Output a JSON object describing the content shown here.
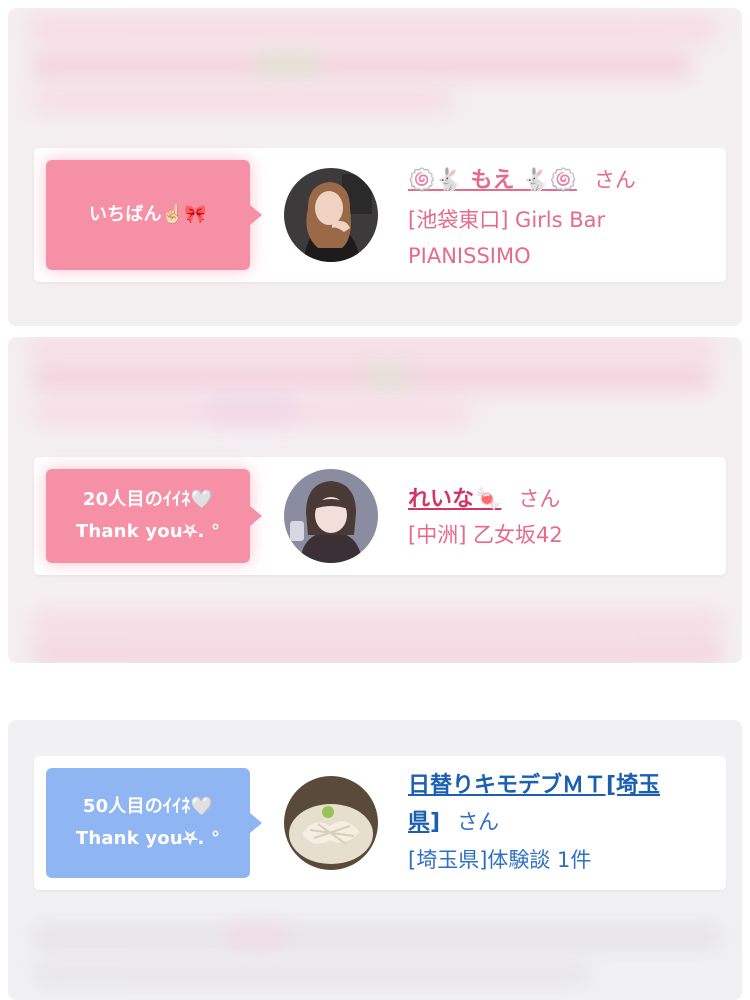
{
  "colors": {
    "pink_text": "#e66a8a",
    "dark_pink": "#d33466",
    "blue_text": "#1b5fb0",
    "blue_shop": "#2f70c4",
    "pink_badge": "#f590a6",
    "blue_badge": "#8fb6f2"
  },
  "cards": [
    {
      "badge_line1": "いちばん☝🏻🎀",
      "badge_line2": "",
      "name": "🍥🐇 もえ 🐇🍥",
      "san": "さん",
      "shop_line1": "[池袋東口] Girls Bar",
      "shop_line2": "PIANISSIMO",
      "avatar_icon": "woman-portrait"
    },
    {
      "badge_line1": "20人目のｲｲﾈ🤍",
      "badge_line2": "Thank you⛧. °",
      "name": "れいな🍬",
      "san": "さん",
      "shop_line1": "[中洲] 乙女坂42",
      "shop_line2": "",
      "avatar_icon": "girl-portrait"
    },
    {
      "badge_line1": "50人目のｲｲﾈ🤍",
      "badge_line2": "Thank you⛧. °",
      "name_line1": "日替りキモデブＭＴ[埼玉",
      "name_line2": "県]",
      "san": "さん",
      "shop_line1": "[埼玉県]体験談 1件",
      "avatar_icon": "ramen-photo"
    }
  ]
}
